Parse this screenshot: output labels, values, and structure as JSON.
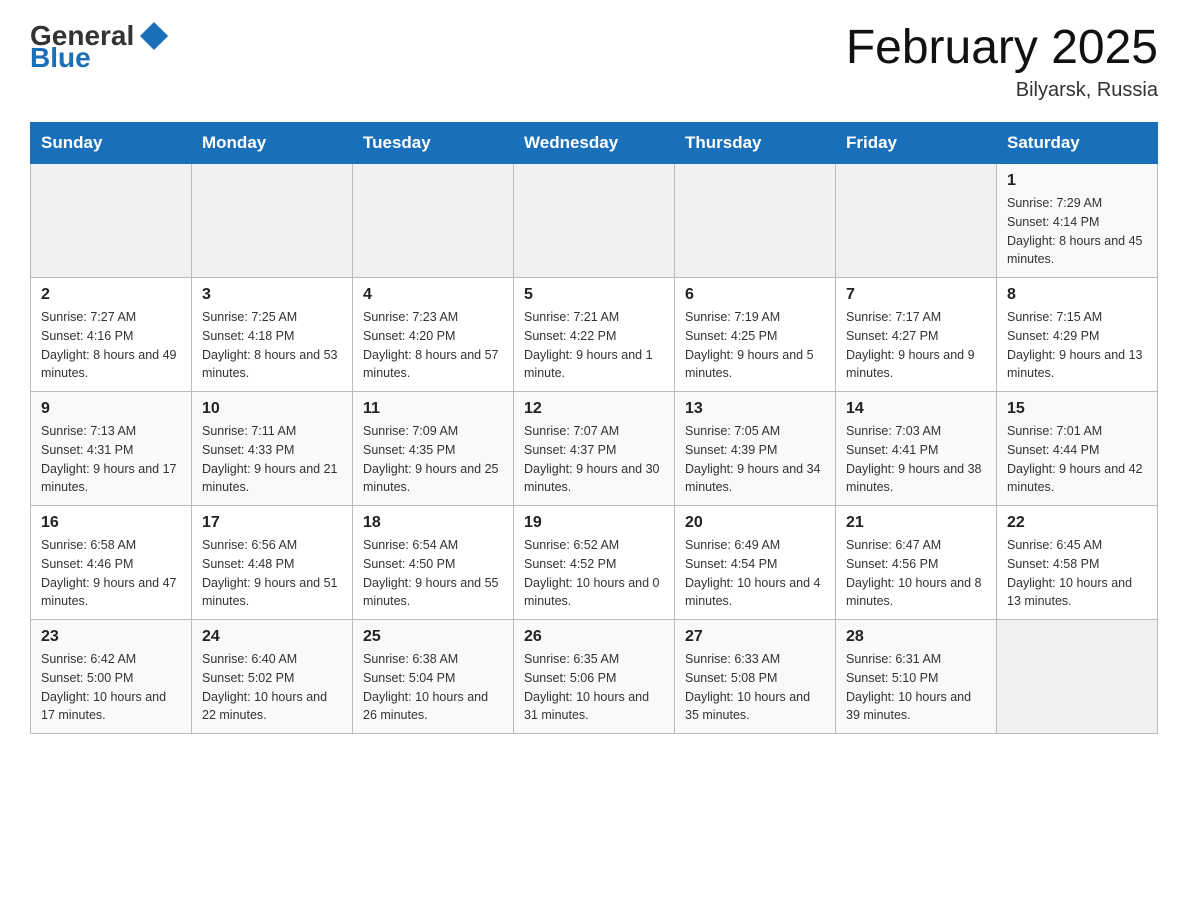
{
  "header": {
    "logo_general": "General",
    "logo_blue": "Blue",
    "title": "February 2025",
    "subtitle": "Bilyarsk, Russia"
  },
  "days_of_week": [
    "Sunday",
    "Monday",
    "Tuesday",
    "Wednesday",
    "Thursday",
    "Friday",
    "Saturday"
  ],
  "weeks": [
    [
      {
        "day": "",
        "info": ""
      },
      {
        "day": "",
        "info": ""
      },
      {
        "day": "",
        "info": ""
      },
      {
        "day": "",
        "info": ""
      },
      {
        "day": "",
        "info": ""
      },
      {
        "day": "",
        "info": ""
      },
      {
        "day": "1",
        "info": "Sunrise: 7:29 AM\nSunset: 4:14 PM\nDaylight: 8 hours and 45 minutes."
      }
    ],
    [
      {
        "day": "2",
        "info": "Sunrise: 7:27 AM\nSunset: 4:16 PM\nDaylight: 8 hours and 49 minutes."
      },
      {
        "day": "3",
        "info": "Sunrise: 7:25 AM\nSunset: 4:18 PM\nDaylight: 8 hours and 53 minutes."
      },
      {
        "day": "4",
        "info": "Sunrise: 7:23 AM\nSunset: 4:20 PM\nDaylight: 8 hours and 57 minutes."
      },
      {
        "day": "5",
        "info": "Sunrise: 7:21 AM\nSunset: 4:22 PM\nDaylight: 9 hours and 1 minute."
      },
      {
        "day": "6",
        "info": "Sunrise: 7:19 AM\nSunset: 4:25 PM\nDaylight: 9 hours and 5 minutes."
      },
      {
        "day": "7",
        "info": "Sunrise: 7:17 AM\nSunset: 4:27 PM\nDaylight: 9 hours and 9 minutes."
      },
      {
        "day": "8",
        "info": "Sunrise: 7:15 AM\nSunset: 4:29 PM\nDaylight: 9 hours and 13 minutes."
      }
    ],
    [
      {
        "day": "9",
        "info": "Sunrise: 7:13 AM\nSunset: 4:31 PM\nDaylight: 9 hours and 17 minutes."
      },
      {
        "day": "10",
        "info": "Sunrise: 7:11 AM\nSunset: 4:33 PM\nDaylight: 9 hours and 21 minutes."
      },
      {
        "day": "11",
        "info": "Sunrise: 7:09 AM\nSunset: 4:35 PM\nDaylight: 9 hours and 25 minutes."
      },
      {
        "day": "12",
        "info": "Sunrise: 7:07 AM\nSunset: 4:37 PM\nDaylight: 9 hours and 30 minutes."
      },
      {
        "day": "13",
        "info": "Sunrise: 7:05 AM\nSunset: 4:39 PM\nDaylight: 9 hours and 34 minutes."
      },
      {
        "day": "14",
        "info": "Sunrise: 7:03 AM\nSunset: 4:41 PM\nDaylight: 9 hours and 38 minutes."
      },
      {
        "day": "15",
        "info": "Sunrise: 7:01 AM\nSunset: 4:44 PM\nDaylight: 9 hours and 42 minutes."
      }
    ],
    [
      {
        "day": "16",
        "info": "Sunrise: 6:58 AM\nSunset: 4:46 PM\nDaylight: 9 hours and 47 minutes."
      },
      {
        "day": "17",
        "info": "Sunrise: 6:56 AM\nSunset: 4:48 PM\nDaylight: 9 hours and 51 minutes."
      },
      {
        "day": "18",
        "info": "Sunrise: 6:54 AM\nSunset: 4:50 PM\nDaylight: 9 hours and 55 minutes."
      },
      {
        "day": "19",
        "info": "Sunrise: 6:52 AM\nSunset: 4:52 PM\nDaylight: 10 hours and 0 minutes."
      },
      {
        "day": "20",
        "info": "Sunrise: 6:49 AM\nSunset: 4:54 PM\nDaylight: 10 hours and 4 minutes."
      },
      {
        "day": "21",
        "info": "Sunrise: 6:47 AM\nSunset: 4:56 PM\nDaylight: 10 hours and 8 minutes."
      },
      {
        "day": "22",
        "info": "Sunrise: 6:45 AM\nSunset: 4:58 PM\nDaylight: 10 hours and 13 minutes."
      }
    ],
    [
      {
        "day": "23",
        "info": "Sunrise: 6:42 AM\nSunset: 5:00 PM\nDaylight: 10 hours and 17 minutes."
      },
      {
        "day": "24",
        "info": "Sunrise: 6:40 AM\nSunset: 5:02 PM\nDaylight: 10 hours and 22 minutes."
      },
      {
        "day": "25",
        "info": "Sunrise: 6:38 AM\nSunset: 5:04 PM\nDaylight: 10 hours and 26 minutes."
      },
      {
        "day": "26",
        "info": "Sunrise: 6:35 AM\nSunset: 5:06 PM\nDaylight: 10 hours and 31 minutes."
      },
      {
        "day": "27",
        "info": "Sunrise: 6:33 AM\nSunset: 5:08 PM\nDaylight: 10 hours and 35 minutes."
      },
      {
        "day": "28",
        "info": "Sunrise: 6:31 AM\nSunset: 5:10 PM\nDaylight: 10 hours and 39 minutes."
      },
      {
        "day": "",
        "info": ""
      }
    ]
  ]
}
